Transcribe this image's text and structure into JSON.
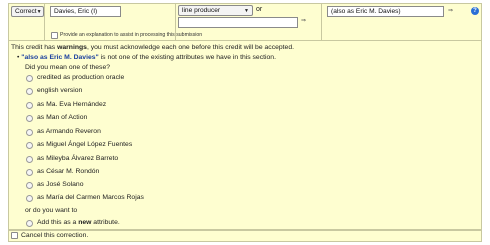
{
  "edit_row": {
    "status_select": "Correct",
    "name_value": "Davies, Eric (I)",
    "role_select": "line producer",
    "or_label": "or",
    "role_input": "",
    "arrow_glyph": "⇒",
    "attribute_value": "(also as Eric M. Davies)",
    "help_label": "?",
    "explanation_label": "Provide an explanation to assist in processing this submission"
  },
  "warning": {
    "intro_start": "This credit has ",
    "intro_bold": "warnings",
    "intro_end": ", you must acknowledge each one before this credit will be accepted.",
    "bullet": "•",
    "item_quote": "\"also as Eric M. Davies\"",
    "item_rest": " is not one of the existing attributes we have in this section.",
    "prompt": "Did you mean one of these?",
    "options": [
      "credited as production oracle",
      "english version",
      "as Ma. Eva Hernández",
      "as Man of Action",
      "as Armando Reveron",
      "as Miguel Ángel López Fuentes",
      "as Mileyba Álvarez Barreto",
      "as César M. Rondón",
      "as José Solano",
      "as María del Carmen Marcos Rojas"
    ],
    "or_prompt": "or do you want to",
    "add_start": "Add this as a ",
    "add_bold": "new",
    "add_end": " attribute."
  },
  "cancel_label": "Cancel this correction.",
  "colors": {
    "panel_bg": "#fefed0",
    "border": "#c8c8a0",
    "link": "#1a3f9e",
    "help_blue": "#2a6fd6"
  }
}
